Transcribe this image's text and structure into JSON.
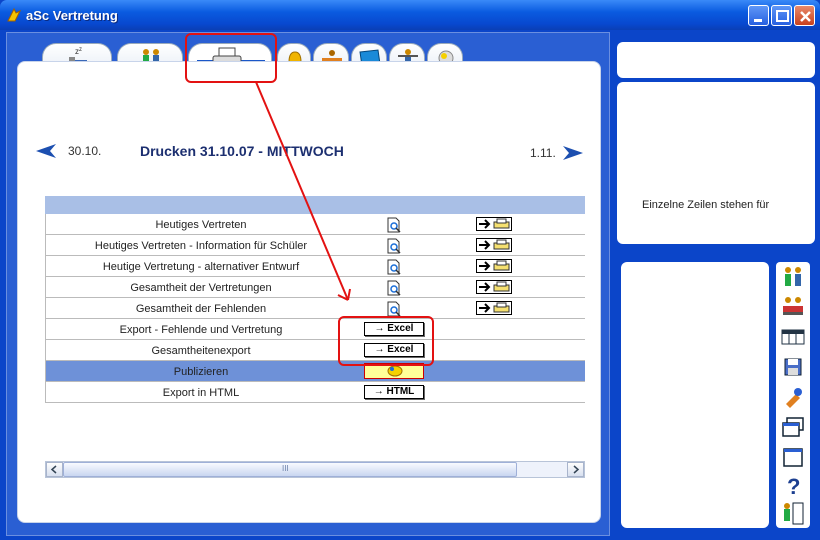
{
  "window": {
    "title": "aSc Vertretung"
  },
  "nav": {
    "prev_date": "30.10.",
    "next_date": "1.11.",
    "heading": "Drucken 31.10.07 - MITTWOCH"
  },
  "rows": [
    {
      "label": "Heutiges Vertreten",
      "kind": "print"
    },
    {
      "label": "Heutiges Vertreten - Information für Schüler",
      "kind": "print"
    },
    {
      "label": "Heutige Vertretung - alternativer Entwurf",
      "kind": "print"
    },
    {
      "label": "Gesamtheit der Vertretungen",
      "kind": "print"
    },
    {
      "label": "Gesamtheit der Fehlenden",
      "kind": "print"
    },
    {
      "label": "Export - Fehlende und Vertretung",
      "kind": "excel"
    },
    {
      "label": "Gesamtheitenexport",
      "kind": "excel"
    },
    {
      "label": "Publizieren",
      "kind": "publish"
    },
    {
      "label": "Export in HTML",
      "kind": "html"
    }
  ],
  "buttons": {
    "excel": "→ Excel",
    "html": "→ HTML"
  },
  "scrollbar": {
    "grip": "III"
  },
  "right_panel": {
    "hint": "Einzelne Zeilen stehen für"
  },
  "colors": {
    "annotation": "#e31212",
    "selected_row": "#6e91d8",
    "header_bar": "#a9bfe6",
    "window_blue": "#0b45c9"
  },
  "icons": {
    "tabs": [
      "sleep-icon",
      "people-icon",
      "printer-icon",
      "bell-icon",
      "desk-icon",
      "book-icon",
      "teacher-icon",
      "globe-icon"
    ],
    "toolbar": [
      "people-icon",
      "classroom-icon",
      "table-icon",
      "save-icon",
      "tools-icon",
      "windows-icon",
      "window-icon",
      "help-icon",
      "exit-icon"
    ]
  }
}
